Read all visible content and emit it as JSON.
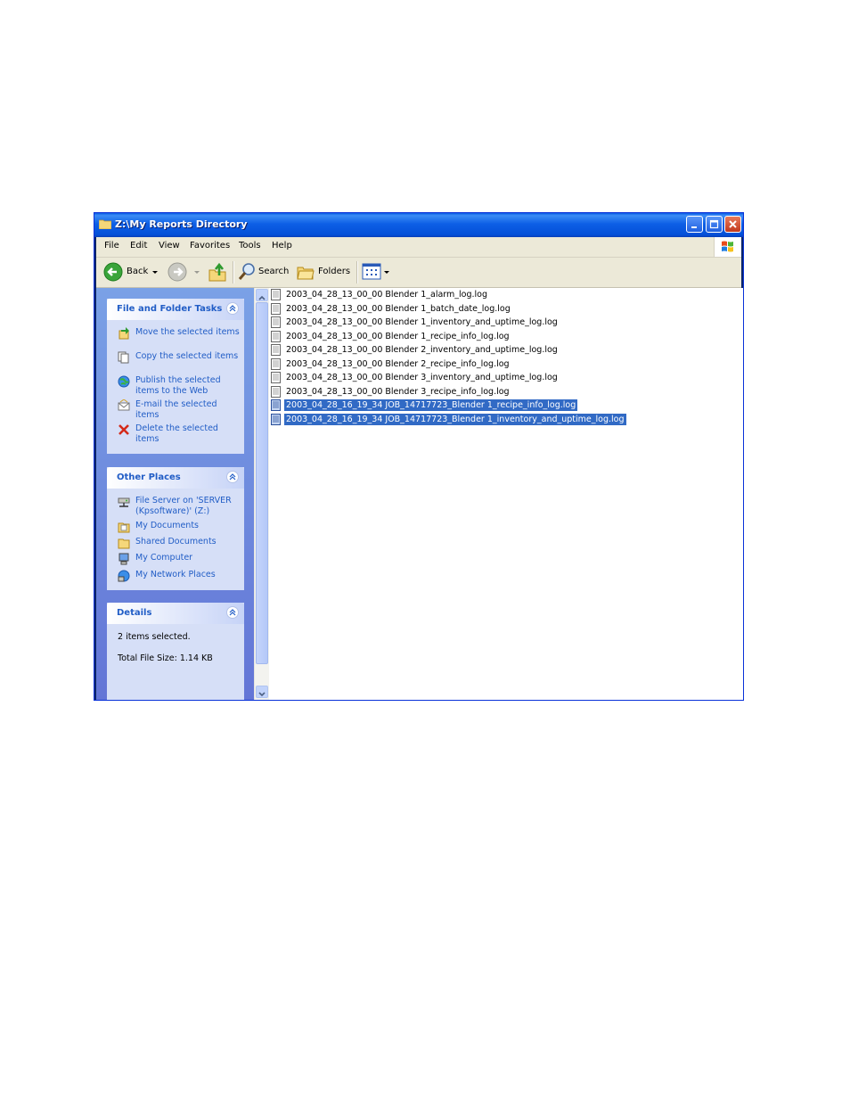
{
  "window": {
    "title": "Z:\\My Reports Directory"
  },
  "menu": [
    "File",
    "Edit",
    "View",
    "Favorites",
    "Tools",
    "Help"
  ],
  "toolbar": {
    "back": "Back",
    "search": "Search",
    "folders": "Folders"
  },
  "tasks_panel": {
    "title": "File and Folder Tasks",
    "items": [
      {
        "label": "Move the selected items",
        "icon": "move-icon"
      },
      {
        "label": "Copy the selected items",
        "icon": "copy-icon"
      },
      {
        "label": "Publish the selected items to the Web",
        "icon": "publish-web-icon"
      },
      {
        "label": "E-mail the selected items",
        "icon": "email-icon"
      },
      {
        "label": "Delete the selected items",
        "icon": "delete-icon"
      }
    ]
  },
  "places_panel": {
    "title": "Other Places",
    "items": [
      {
        "label": "File Server on 'SERVER (Kpsoftware)' (Z:)",
        "icon": "network-drive-icon"
      },
      {
        "label": "My Documents",
        "icon": "my-documents-icon"
      },
      {
        "label": "Shared Documents",
        "icon": "folder-icon"
      },
      {
        "label": "My Computer",
        "icon": "my-computer-icon"
      },
      {
        "label": "My Network Places",
        "icon": "network-places-icon"
      }
    ]
  },
  "details_panel": {
    "title": "Details",
    "selected": "2 items selected.",
    "size": "Total File Size: 1.14 KB"
  },
  "files": [
    {
      "name": "2003_04_28_13_00_00 Blender 1_alarm_log.log",
      "selected": false
    },
    {
      "name": "2003_04_28_13_00_00 Blender 1_batch_date_log.log",
      "selected": false
    },
    {
      "name": "2003_04_28_13_00_00 Blender 1_inventory_and_uptime_log.log",
      "selected": false
    },
    {
      "name": "2003_04_28_13_00_00 Blender 1_recipe_info_log.log",
      "selected": false
    },
    {
      "name": "2003_04_28_13_00_00 Blender 2_inventory_and_uptime_log.log",
      "selected": false
    },
    {
      "name": "2003_04_28_13_00_00 Blender 2_recipe_info_log.log",
      "selected": false
    },
    {
      "name": "2003_04_28_13_00_00 Blender 3_inventory_and_uptime_log.log",
      "selected": false
    },
    {
      "name": "2003_04_28_13_00_00 Blender 3_recipe_info_log.log",
      "selected": false
    },
    {
      "name": "2003_04_28_16_19_34 JOB_14717723_Blender 1_recipe_info_log.log",
      "selected": true
    },
    {
      "name": "2003_04_28_16_19_34 JOB_14717723_Blender 1_inventory_and_uptime_log.log",
      "selected": true
    }
  ],
  "colors": {
    "titlebar": "#0a5ae3",
    "selection": "#316ac5",
    "task_link": "#215dc6",
    "taskpane": "#6375d6"
  }
}
